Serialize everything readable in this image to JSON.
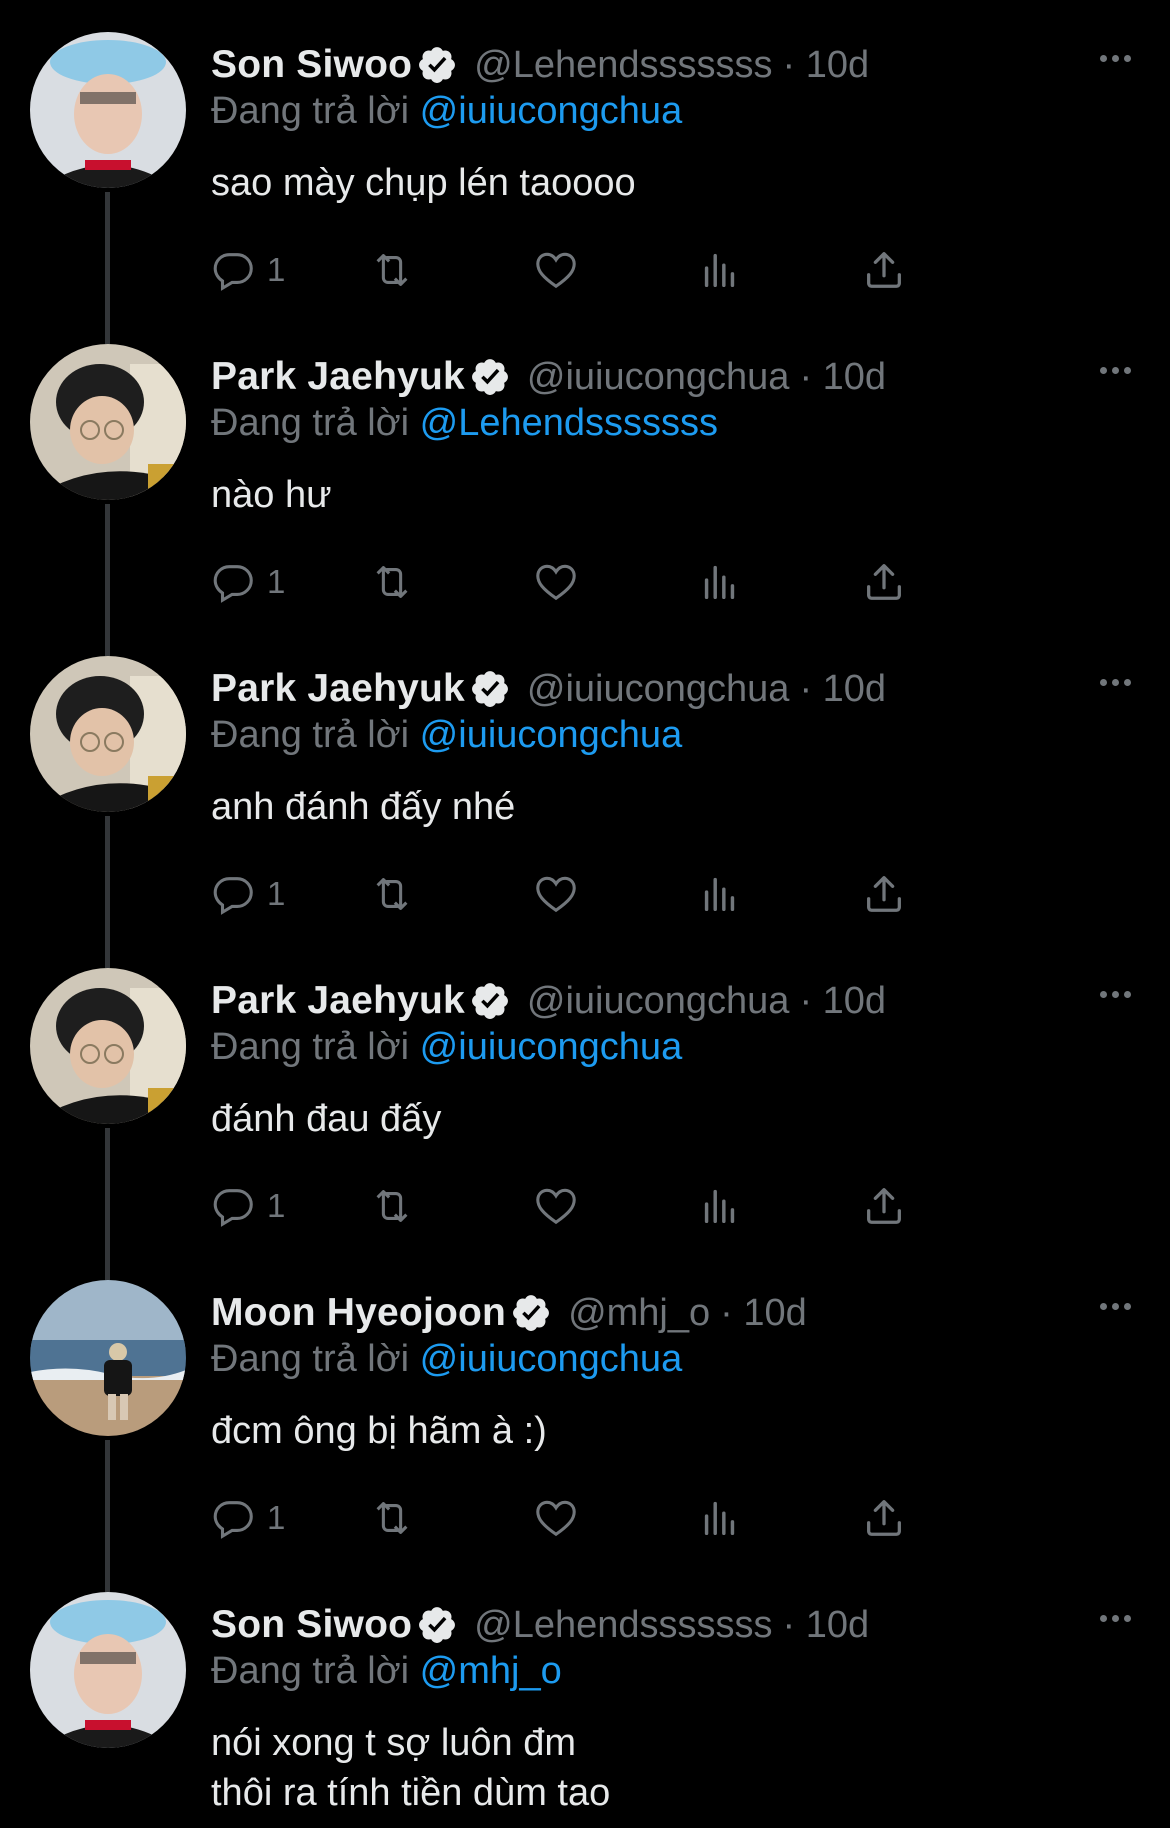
{
  "reply_prefix": "Đang trả lời",
  "tweets": [
    {
      "name": "Son Siwoo",
      "handle": "@Lehendsssssss",
      "time": "· 10d",
      "reply_to": "@iuiucongchua",
      "lines": [
        "sao mày chụp lén taoooo"
      ],
      "reply_count": "1",
      "avatar_icon": "avatar-photo-blue-hat"
    },
    {
      "name": "Park Jaehyuk",
      "handle": "@iuiucongchua",
      "time": "· 10d",
      "reply_to": "@Lehendsssssss",
      "lines": [
        "nào hư"
      ],
      "reply_count": "1",
      "avatar_icon": "avatar-photo-glasses"
    },
    {
      "name": "Park Jaehyuk",
      "handle": "@iuiucongchua",
      "time": "· 10d",
      "reply_to": "@iuiucongchua",
      "lines": [
        "anh đánh đấy nhé"
      ],
      "reply_count": "1",
      "avatar_icon": "avatar-photo-glasses"
    },
    {
      "name": "Park Jaehyuk",
      "handle": "@iuiucongchua",
      "time": "· 10d",
      "reply_to": "@iuiucongchua",
      "lines": [
        "đánh đau đấy"
      ],
      "reply_count": "1",
      "avatar_icon": "avatar-photo-glasses"
    },
    {
      "name": "Moon Hyeojoon",
      "handle": "@mhj_o",
      "time": "· 10d",
      "reply_to": "@iuiucongchua",
      "lines": [
        "đcm ông bị hãm à :)"
      ],
      "reply_count": "1",
      "avatar_icon": "avatar-photo-beach"
    },
    {
      "name": "Son Siwoo",
      "handle": "@Lehendsssssss",
      "time": "· 10d",
      "reply_to": "@mhj_o",
      "lines": [
        "nói xong t sợ luôn đm",
        "thôi ra tính tiền dùm tao"
      ],
      "reply_count": "",
      "avatar_icon": "avatar-photo-blue-hat"
    }
  ],
  "colors": {
    "background": "#000000",
    "text_primary": "#e7e9ea",
    "text_secondary": "#71767b",
    "accent": "#1d9bf0",
    "rail": "#333639"
  }
}
